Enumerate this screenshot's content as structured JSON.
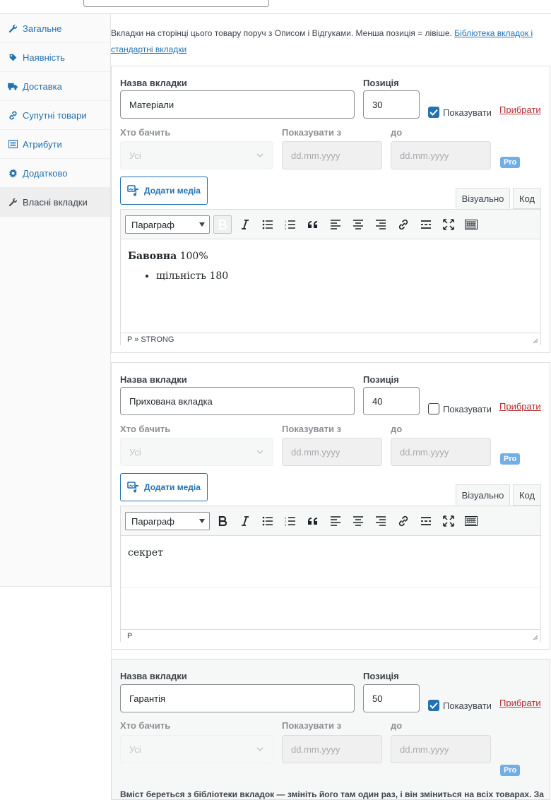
{
  "sidebar": {
    "items": [
      {
        "label": "Загальне",
        "icon": "wrench-icon"
      },
      {
        "label": "Наявність",
        "icon": "tag-icon"
      },
      {
        "label": "Доставка",
        "icon": "truck-icon"
      },
      {
        "label": "Супутні товари",
        "icon": "link-icon"
      },
      {
        "label": "Атрибути",
        "icon": "list-icon"
      },
      {
        "label": "Додатково",
        "icon": "gear-icon"
      },
      {
        "label": "Власні вкладки",
        "icon": "wrench-icon",
        "active": true
      }
    ]
  },
  "intro": {
    "text": "Вкладки на сторінці цього товару поруч з Описом і Відгуками. Менша позиція = лівіше.",
    "link": "Бібліотека вкладок і стандартні вкладки"
  },
  "labels": {
    "tab_name": "Назва вкладки",
    "position": "Позиція",
    "show": "Показувати",
    "remove": "Прибрати",
    "who_sees": "Хто бачить",
    "show_from": "Показувати з",
    "to": "до",
    "date_placeholder": "dd.mm.yyyy",
    "audience": "Усі",
    "pro": "Pro",
    "add_media": "Додати медіа",
    "visual": "Візуально",
    "code": "Код",
    "format": "Параграф"
  },
  "tabs": [
    {
      "name": "Матеріали",
      "position": "30",
      "shown": true,
      "content_bold": "Бавовна",
      "content_rest": " 100%",
      "bullet": "щільність 180",
      "path": "P » STRONG"
    },
    {
      "name": "Прихована вкладка",
      "position": "40",
      "shown": false,
      "content_text": "секрет",
      "path": "P"
    },
    {
      "name": "Гарантія",
      "position": "50",
      "shown": true,
      "footnote": "Вміст береться з бібліотеки вкладок — змініть його там один раз, і він зміниться на всіх товарах. Залиште"
    }
  ],
  "colors": {
    "accent": "#2271b1",
    "remove": "#b32d2e",
    "pro_badge": "#72aee6"
  }
}
